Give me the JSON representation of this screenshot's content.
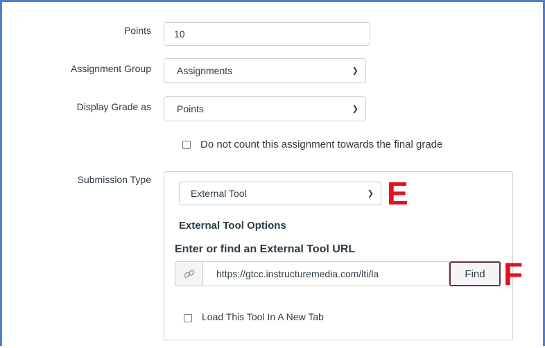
{
  "fields": {
    "points_label": "Points",
    "points_value": "10",
    "assignment_group_label": "Assignment Group",
    "assignment_group_value": "Assignments",
    "display_grade_label": "Display Grade as",
    "display_grade_value": "Points",
    "final_grade_checkbox_label": "Do not count this assignment towards the final grade",
    "submission_type_label": "Submission Type",
    "submission_type_value": "External Tool"
  },
  "external_tool": {
    "options_heading": "External Tool Options",
    "url_heading": "Enter or find an External Tool URL",
    "url_value": "https://gtcc.instructuremedia.com/lti/la",
    "find_label": "Find",
    "new_tab_label": "Load This Tool In A New Tab"
  },
  "annotations": {
    "marker_e": "E",
    "marker_f": "F",
    "color": "#e0121e"
  },
  "icons": {
    "chevron": "chevron-down-icon",
    "link": "link-icon"
  },
  "colors": {
    "frame_border": "#4d7fcd",
    "text": "#2d3b45",
    "input_border": "#c7cdd1",
    "find_border": "#6b2d4a"
  }
}
